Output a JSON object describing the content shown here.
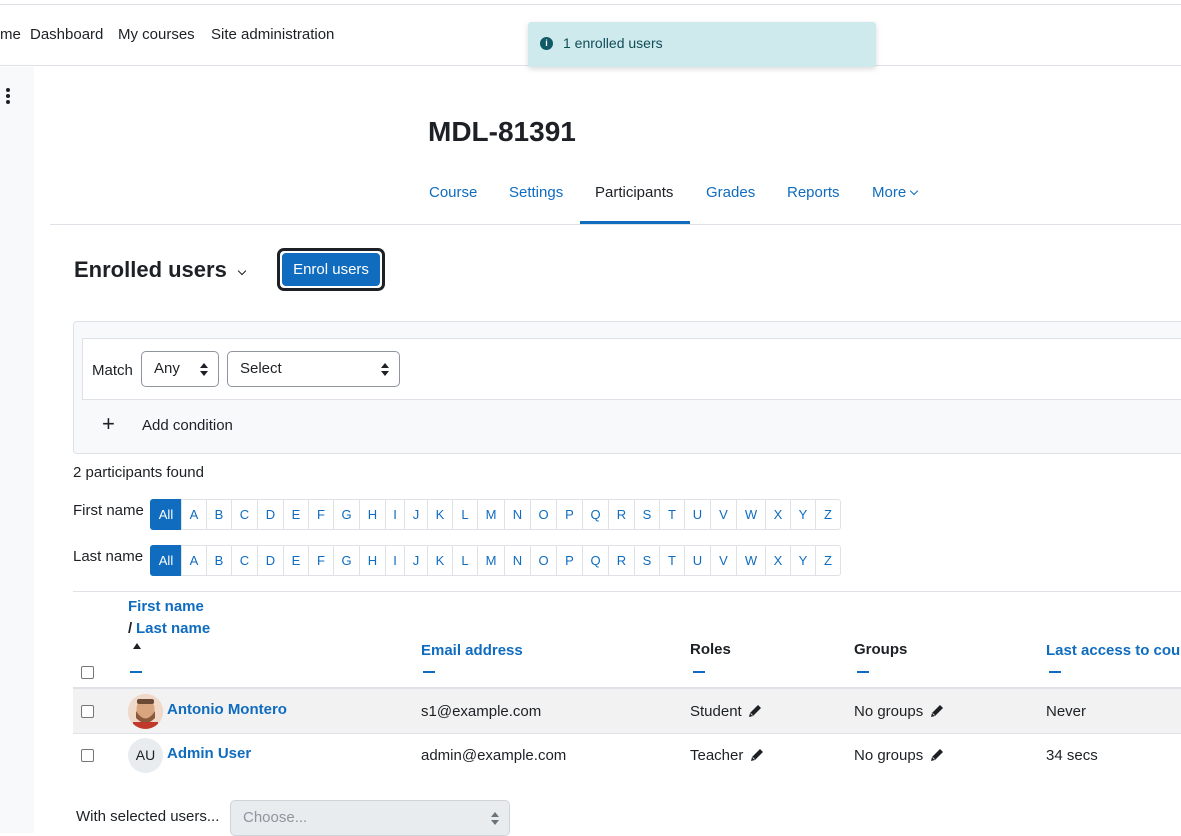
{
  "navbar": {
    "items": [
      {
        "label": "me"
      },
      {
        "label": "Dashboard"
      },
      {
        "label": "My courses"
      },
      {
        "label": "Site administration"
      }
    ]
  },
  "toast": {
    "message": "1 enrolled users",
    "icon": "info-circle-icon",
    "background": "#cfeaed"
  },
  "course": {
    "title": "MDL-81391"
  },
  "secondary_nav": {
    "tabs": [
      {
        "label": "Course"
      },
      {
        "label": "Settings"
      },
      {
        "label": "Participants",
        "active": true
      },
      {
        "label": "Grades"
      },
      {
        "label": "Reports"
      },
      {
        "label": "More"
      }
    ]
  },
  "page": {
    "heading": "Enrolled users",
    "enrol_button": "Enrol users"
  },
  "filter": {
    "match_label": "Match",
    "match_value": "Any",
    "type_value": "Select",
    "add_condition": "Add condition",
    "add_icon": "+"
  },
  "results": {
    "count_text": "2 participants found"
  },
  "initials_bar": {
    "first_label": "First name",
    "last_label": "Last name",
    "all_label": "All",
    "letters": [
      "A",
      "B",
      "C",
      "D",
      "E",
      "F",
      "G",
      "H",
      "I",
      "J",
      "K",
      "L",
      "M",
      "N",
      "O",
      "P",
      "Q",
      "R",
      "S",
      "T",
      "U",
      "V",
      "W",
      "X",
      "Y",
      "Z"
    ]
  },
  "table": {
    "headers": {
      "first_name": "First name",
      "slash": "/",
      "last_name": "Last name",
      "email": "Email address",
      "roles": "Roles",
      "groups": "Groups",
      "last_access": "Last access to cou"
    },
    "rows": [
      {
        "name": "Antonio Montero",
        "email": "s1@example.com",
        "role": "Student",
        "groups": "No groups",
        "last_access": "Never",
        "avatar": "photo"
      },
      {
        "name": "Admin User",
        "initials": "AU",
        "email": "admin@example.com",
        "role": "Teacher",
        "groups": "No groups",
        "last_access": "34 secs",
        "avatar": "initials"
      }
    ]
  },
  "bulk": {
    "label": "With selected users...",
    "placeholder": "Choose..."
  },
  "colors": {
    "primary": "#0f6cbf",
    "text": "#1d2125",
    "border": "#dee2e6"
  }
}
